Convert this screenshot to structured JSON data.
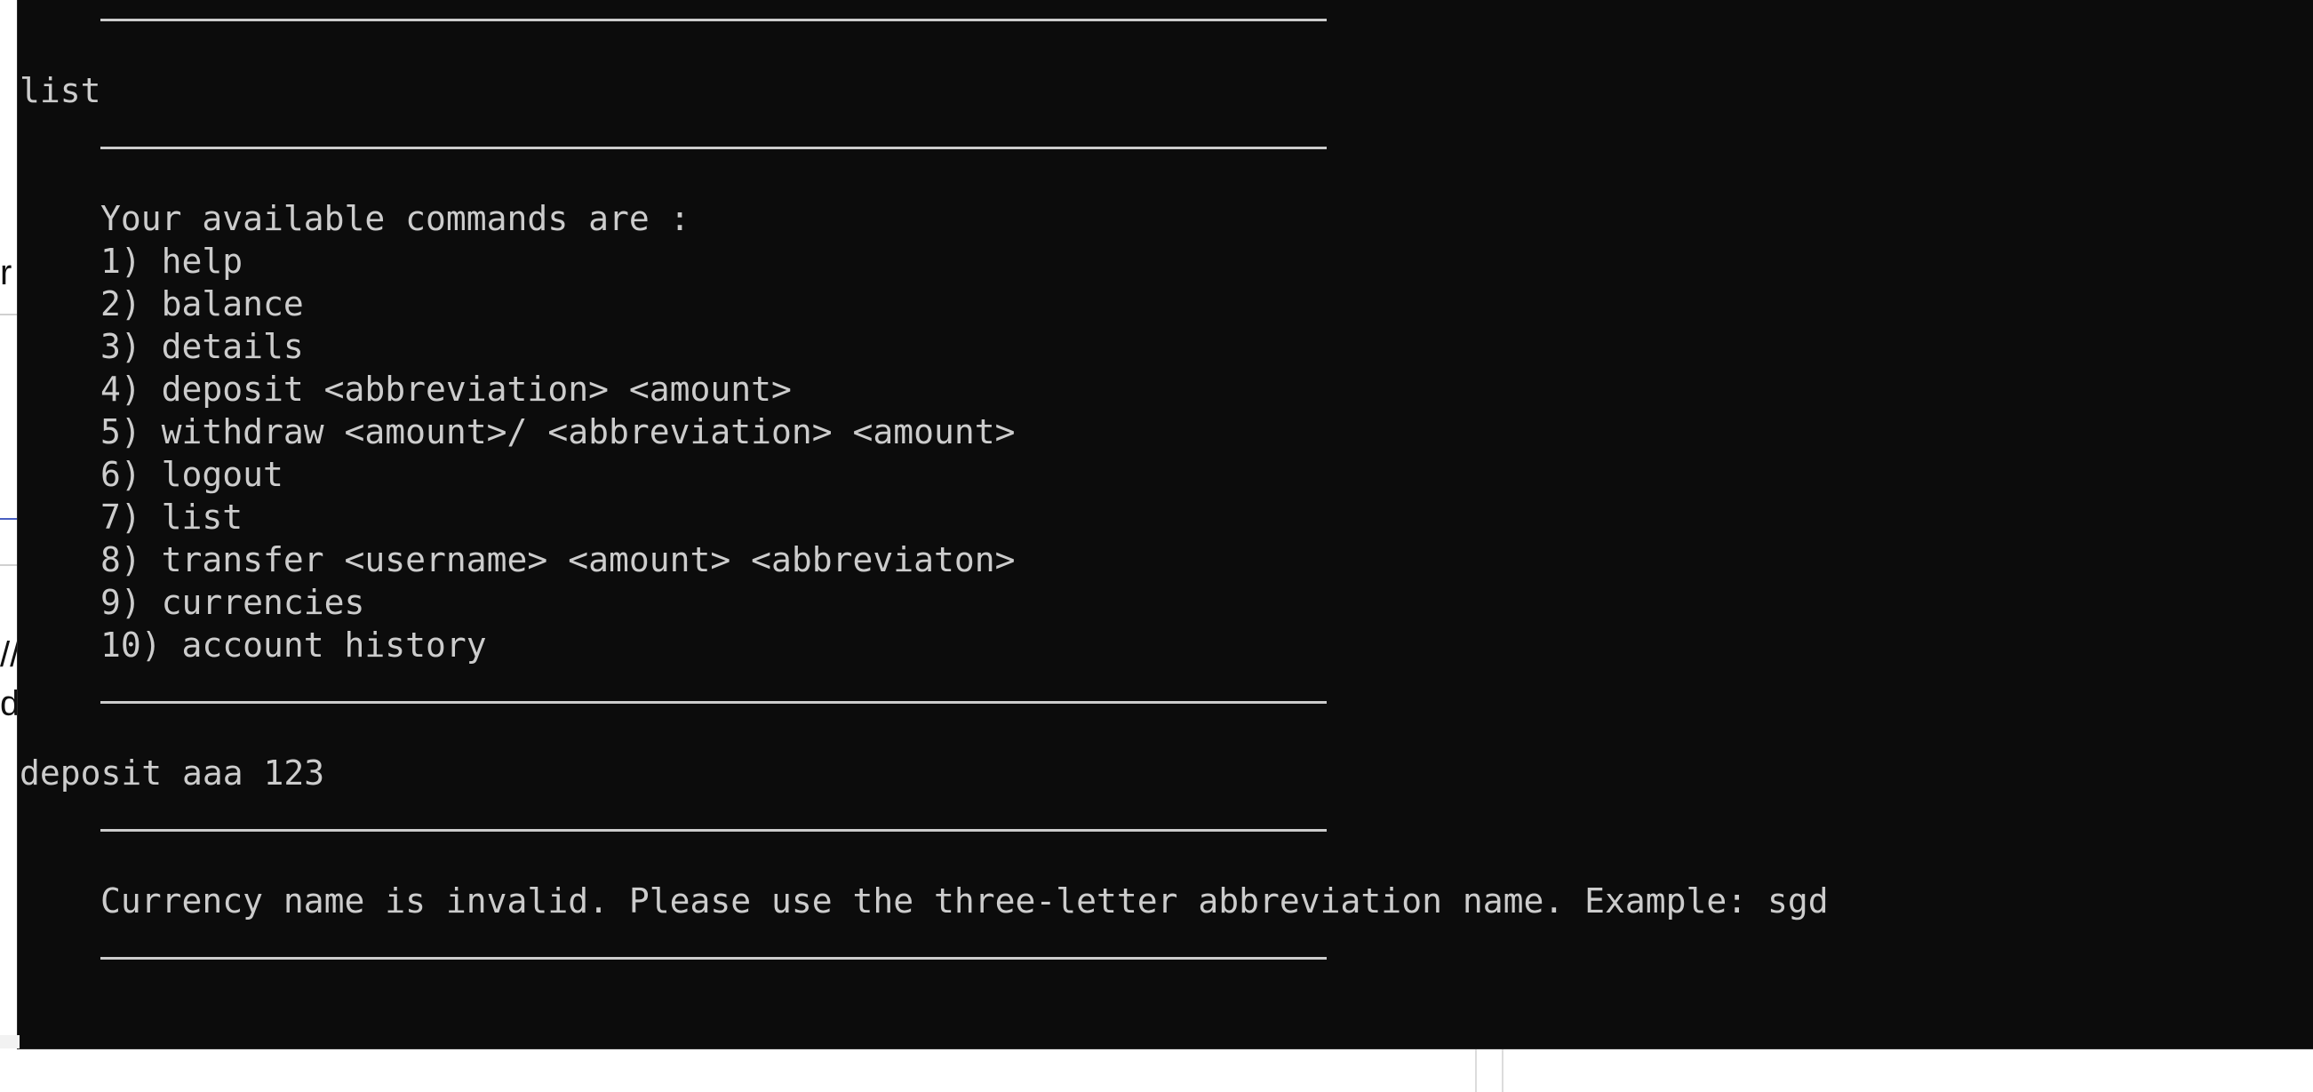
{
  "background_window": {
    "fragments": [
      "r",
      "//",
      "d"
    ]
  },
  "console": {
    "lines": {
      "cmd_list": "list",
      "help_heading": "Your available commands are :",
      "commands": [
        "1) help",
        "2) balance",
        "3) details",
        "4) deposit <abbreviation> <amount>",
        "5) withdraw <amount>/ <abbreviation> <amount>",
        "6) logout",
        "7) list",
        "8) transfer <username> <amount> <abbreviaton>",
        "9) currencies",
        "10) account history"
      ],
      "cmd_deposit": "deposit aaa 123",
      "error_message": "Currency name is invalid. Please use the three-letter abbreviation name. Example: sgd"
    }
  },
  "colors": {
    "console_background": "#0c0c0c",
    "console_text": "#cccccc",
    "background_window": "#ffffff"
  }
}
